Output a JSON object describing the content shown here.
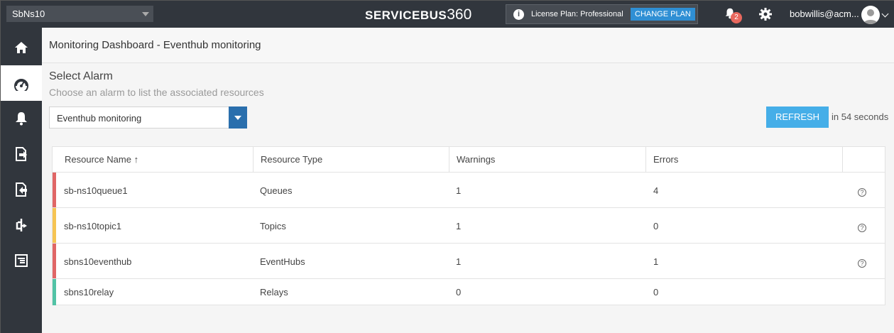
{
  "topbar": {
    "namespace": "SbNs10",
    "brand_text": "SERVICEBUS",
    "brand_num": "360",
    "license_label": "License Plan: Professional",
    "change_plan": "CHANGE PLAN",
    "notification_count": "2",
    "user": "bobwillis@acm..."
  },
  "sidebar": {
    "items": [
      {
        "icon": "home-icon"
      },
      {
        "icon": "dashboard-icon",
        "active": true
      },
      {
        "icon": "bell-icon"
      },
      {
        "icon": "document-export-icon"
      },
      {
        "icon": "document-import-icon"
      },
      {
        "icon": "topology-icon"
      },
      {
        "icon": "list-tree-icon"
      }
    ]
  },
  "main": {
    "page_title": "Monitoring Dashboard - Eventhub monitoring",
    "section_title": "Select Alarm",
    "section_sub": "Choose an alarm to list the associated resources",
    "alarm_value": "Eventhub monitoring",
    "refresh_label": "REFRESH",
    "refresh_note": "in 54 seconds"
  },
  "table": {
    "headers": [
      "Resource Name",
      "Resource Type",
      "Warnings",
      "Errors"
    ],
    "sort_indicator": "↑",
    "rows": [
      {
        "name": "sb-ns10queue1",
        "type": "Queues",
        "warnings": "1",
        "errors": "4",
        "status_color": "#e06666",
        "help": "?"
      },
      {
        "name": "sb-ns10topic1",
        "type": "Topics",
        "warnings": "1",
        "errors": "0",
        "status_color": "#f6c453",
        "help": "?"
      },
      {
        "name": "sbns10eventhub",
        "type": "EventHubs",
        "warnings": "1",
        "errors": "1",
        "status_color": "#e06666",
        "help": "?"
      },
      {
        "name": "sbns10relay",
        "type": "Relays",
        "warnings": "0",
        "errors": "0",
        "status_color": "#52c3a6",
        "help": ""
      }
    ]
  }
}
